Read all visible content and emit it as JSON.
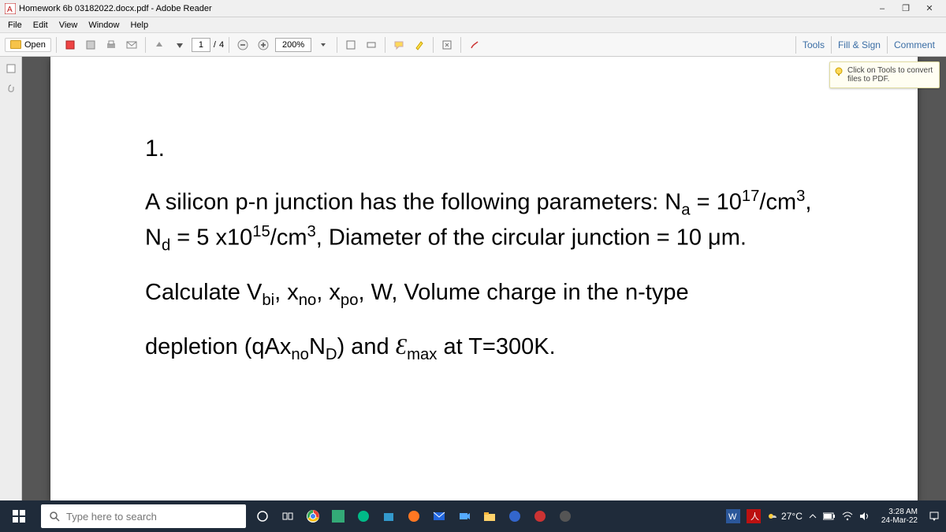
{
  "window": {
    "title": "Homework 6b 03182022.docx.pdf - Adobe Reader",
    "minimize": "–",
    "maximize": "❐",
    "close": "✕"
  },
  "menu": {
    "file": "File",
    "edit": "Edit",
    "view": "View",
    "window": "Window",
    "help": "Help"
  },
  "toolbar": {
    "open_label": "Open",
    "page_current": "1",
    "page_sep": " / ",
    "page_total": "4",
    "zoom_value": "200%",
    "tools": "Tools",
    "fill_sign": "Fill & Sign",
    "comment": "Comment"
  },
  "tip_text": "Click on Tools to convert files to PDF.",
  "document": {
    "q_number": "1.",
    "para1_html": "A silicon p-n junction has the following parameters: N<sub>a</sub> = 10<sup>17</sup>/cm<sup>3</sup>, N<sub>d</sub> = 5 x10<sup>15</sup>/cm<sup>3</sup>, Diameter of the circular junction = 10 μm.",
    "para2_html": "Calculate V<sub>bi</sub>, x<sub>no</sub>, x<sub>po</sub>, W, Volume charge in the n-type",
    "para3_html": "depletion (qAx<sub>no</sub>N<sub>D</sub>) and <span class='calE'>Ɛ</span><sub>max</sub> at T=300K."
  },
  "taskbar": {
    "search_placeholder": "Type here to search",
    "weather": "27°C",
    "time": "3:28 AM",
    "date": "24-Mar-22"
  }
}
